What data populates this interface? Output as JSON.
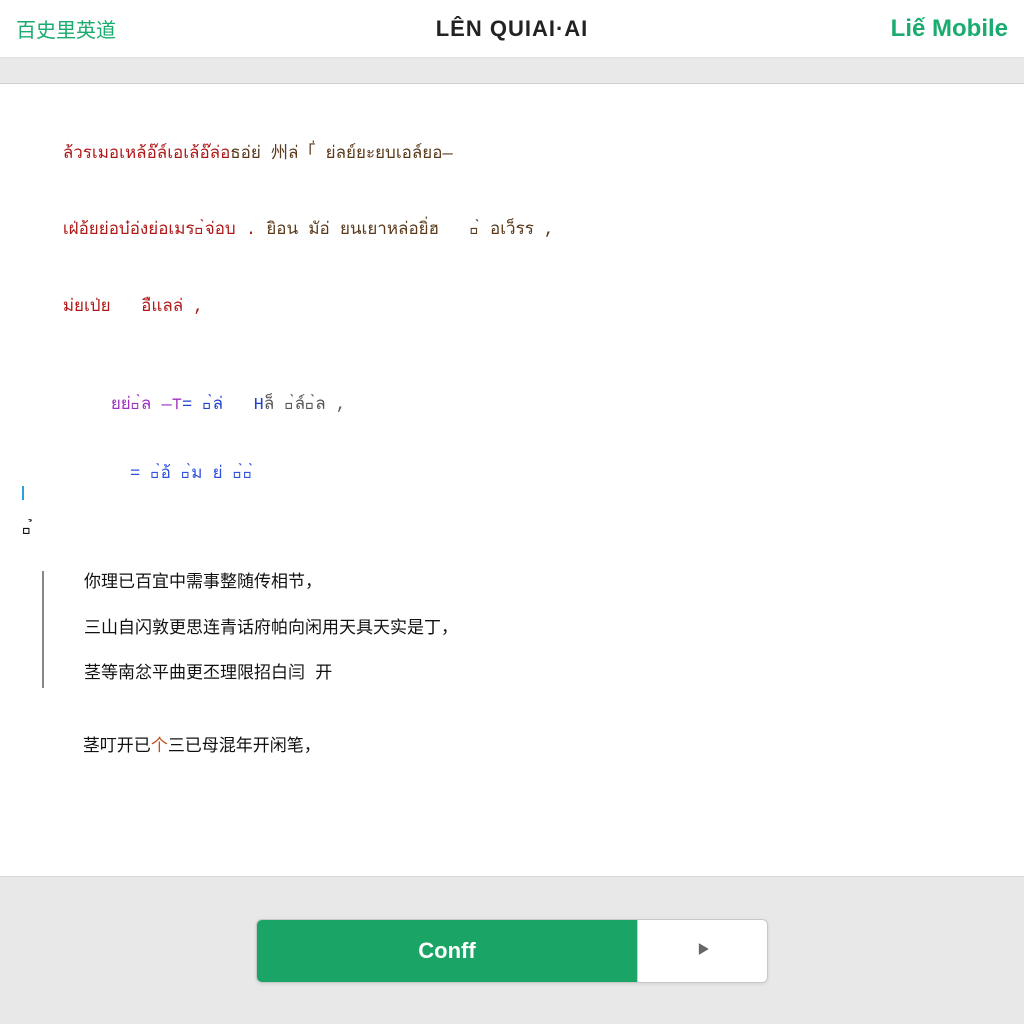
{
  "header": {
    "left_label": "百史里英道",
    "title": "LÊN QUIAI·AI",
    "right_label": "Liế Mobile"
  },
  "editor": {
    "red_block": {
      "line1_a": "ล้วรเมอเหล้อ๊ล์เอเล้อ๊ล่อ",
      "line1_b": "ธอ่ย่ 州ล่「่ ย่ลย์ยะยบเอล์ยอ—",
      "line2_a": "เฝ่อ้ยย่อบ๋อ่งย่อเมรย̀จ่อบ . ",
      "line2_b": "ยิอน มัอ่ ยนเยาหล่อยิ่ฮ   อ̀ อเว็รร ,",
      "line3": "ม่ยเป่ย   อืแลล่ ,"
    },
    "mid1": {
      "purple": "ยย่อ̀ล —⊤",
      "blue": "= ย̀ล่   H",
      "gray": "ล็ อ̀ล์อ̀ล ,"
    },
    "mid2": "= ย̀อ้ อ̀ม ย่ ย̀ย̀",
    "left_token": "ย̉",
    "quote": {
      "l1": "你理已百宜中需事整随传相节，",
      "l2": "三山自闪敦更思连青话府帕向闲用天具天实是丁，",
      "l3": "茎等南忿平曲更丕理限招白闫 开"
    },
    "last": {
      "a": "茎叮开已",
      "red": "个",
      "b": "三已母混年开闲笔，"
    }
  },
  "footer": {
    "primary_label": "Conff"
  },
  "colors": {
    "accent": "#1aa566",
    "accent_text": "#1aab6e"
  }
}
